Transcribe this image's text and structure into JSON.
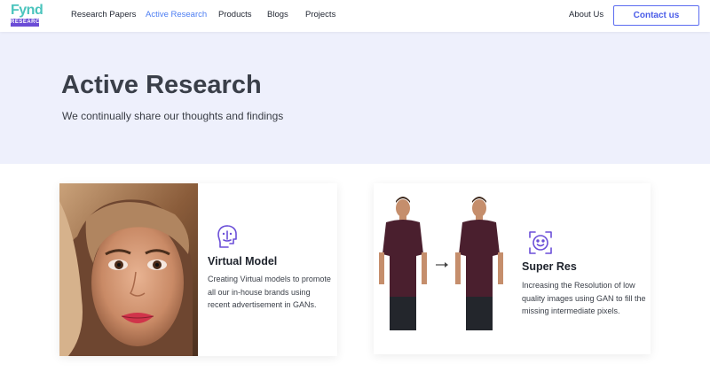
{
  "brand": {
    "name": "Fynd",
    "sub": "RESEARCH"
  },
  "nav": {
    "links": [
      {
        "label": "Research Papers",
        "active": false
      },
      {
        "label": "Active Research",
        "active": true
      },
      {
        "label": "Products",
        "active": false
      },
      {
        "label": "Blogs",
        "active": false
      },
      {
        "label": "Projects",
        "active": false
      },
      {
        "label": "About Us",
        "active": false
      }
    ],
    "contact_label": "Contact us"
  },
  "hero": {
    "title": "Active Research",
    "subtitle": "We continually share our thoughts and findings"
  },
  "cards": [
    {
      "icon": "face-scan-icon",
      "title": "Virtual Model",
      "description": "Creating Virtual models to promote all our in-house brands using recent advertisement in GANs."
    },
    {
      "icon": "smiley-scan-icon",
      "title": "Super Res",
      "description": "Increasing the Resolution of low quality images using GAN to fill the missing intermediate pixels."
    }
  ],
  "colors": {
    "accent": "#4d7ef2",
    "brand_teal": "#4bc4bd",
    "brand_purple": "#6a4bd6",
    "hero_bg": "#eef0fc",
    "icon_purple": "#6b4fd8",
    "shirt": "#4a1f2e"
  }
}
